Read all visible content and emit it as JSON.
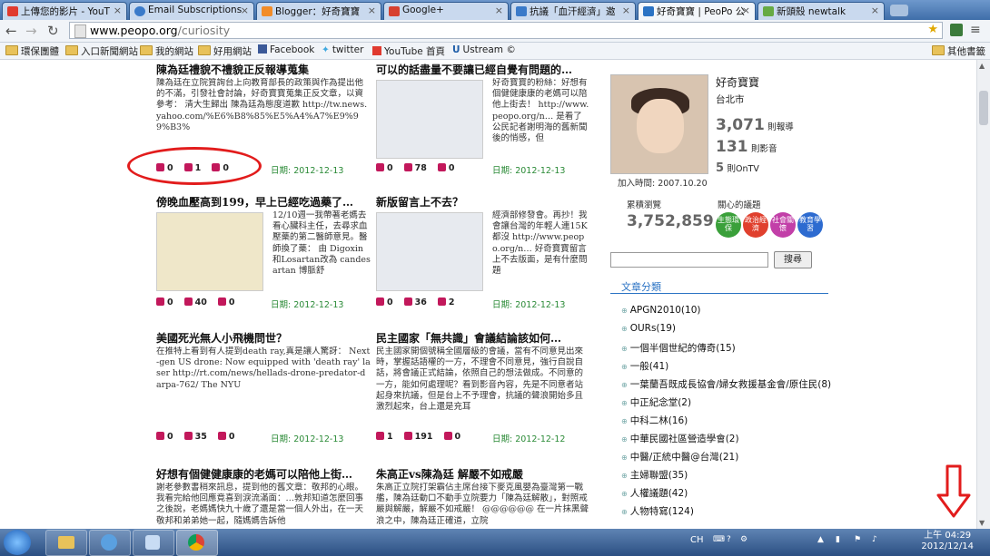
{
  "browser": {
    "tabs": [
      {
        "label": "上傳您的影片 - YouT",
        "color": "#e03a2f",
        "active": false
      },
      {
        "label": "Email Subscriptions",
        "color": "#3a7ac9",
        "active": false
      },
      {
        "label": "Blogger：好奇寶寶",
        "color": "#f28c28",
        "active": false
      },
      {
        "label": "Google+",
        "color": "#d7402f",
        "active": false
      },
      {
        "label": "抗議「血汗經濟」邀",
        "color": "#3a7ac9",
        "active": false
      },
      {
        "label": "好奇寶寶 | PeoPo 公",
        "color": "#2b73c4",
        "active": true
      },
      {
        "label": "新頭殼 newtalk",
        "color": "#66aa44",
        "active": false
      }
    ],
    "url_domain": "www.peopo.org",
    "url_path": "/curiosity",
    "bookmarks": [
      "環保團體",
      "入口新聞網站",
      "我的網站",
      "好用網站",
      "Facebook",
      "twitter",
      "YouTube 首頁",
      "Ustream ©"
    ],
    "other_bookmarks": "其他書籤"
  },
  "posts": [
    {
      "title": "陳為廷禮貌不禮貌正反報導蒐集",
      "body": "陳為廷在立院質詢台上向教育部長的政策與作為提出他的不滿，引發社會討論，好奇寶寶蒐集正反文章，以資參考： 清大生歸出 陳為廷為態度道歉 http://tw.news.yahoo.com/%E6%B8%85%E5%A4%A7%E9%99%B3%",
      "recommend": "0",
      "views": "1",
      "comments": "0",
      "date": "日期: 2012-12-13"
    },
    {
      "title": "可以的話盡量不要讓已經自覺有問題的…",
      "body": "好奇寶寶的粉絲：好想有個健健康康的老媽可以陪他上街去！ http://www.peopo.org/n… 是看了公民記者謝明海的舊新聞後的悄感，但",
      "recommend": "0",
      "views": "78",
      "comments": "0",
      "date": "日期: 2012-12-13"
    },
    {
      "title": "傍晚血壓高到199，早上已經吃過藥了…",
      "body": "12/10週一我帶著老媽去看心臟科主任，去尋求血壓藥的第二醫師意見。醫師換了藥： 由 Digoxin和Losartan改為 candesartan 博脈舒",
      "recommend": "0",
      "views": "40",
      "comments": "0",
      "date": "日期: 2012-12-13"
    },
    {
      "title": "新版留言上不去？",
      "body": "經濟部修發會。再抄！我會讓台灣的年輕人連15K都沒 http://www.peopo.org/n… 好奇寶寶留言上不去版面，是有什麼問題",
      "recommend": "0",
      "views": "36",
      "comments": "2",
      "date": "日期: 2012-12-13"
    },
    {
      "title": "美國死光無人小飛機問世？",
      "body": "在推特上看到有人提到death ray,真是讓人驚訝： Next-gen US drone: Now equipped with 'death ray' laser http://rt.com/news/hellads-drone-predator-darpa-762/ The NYU",
      "recommend": "0",
      "views": "35",
      "comments": "0",
      "date": "日期: 2012-12-13"
    },
    {
      "title": "民主國家「無共識」會議結論該如何…",
      "body": "民主國家開個號稱全國層級的會議，當有不同意見出來時，掌握話語權的一方，不理會不同意見，強行自說自話，將會議正式結論，依照自己的想法做成。不同意的一方，能如何處理呢？看到影音內容，先是不同意者站起身來抗議，但是台上不予理會，抗議的聲浪開始多且激烈起來，台上還是充耳",
      "recommend": "1",
      "views": "191",
      "comments": "0",
      "date": "日期: 2012-12-12"
    },
    {
      "title": "好想有個健健康康的老媽可以陪他上街…",
      "body": "謝老參數書稍來訊息，提到他的舊文章：敬邦的心眼。我看完給他回應竟喜到淚流滿面：…敦邦知道怎麼回事之後說，老媽媽快九十歲了還是當一個人外出，在一天敬邦和弟弟她一起，隨媽媽告訴他",
      "recommend": "",
      "views": "",
      "comments": "",
      "date": ""
    },
    {
      "title": "朱高正vs陳為廷 解嚴不如戒嚴",
      "body": "朱高正立院打架霸佔主席台接下麥克風嬰為臺灣第一戰艦，陳為廷動口不動手立院要力「陳為廷解散」，對照戒嚴與解嚴，解嚴不如戒嚴！ @@@@@@ 在一片抹黑聲浪之中，陳為廷正確道，立院",
      "recommend": "",
      "views": "",
      "comments": "",
      "date": ""
    }
  ],
  "profile": {
    "name": "好奇寶寶",
    "city": "台北市",
    "reports_num": "3,071",
    "reports_label": "則報導",
    "videos_num": "131",
    "videos_label": "則影音",
    "ontv_num": "5",
    "ontv_label": "則OnTV",
    "joined": "加入時間: 2007.10.20",
    "views_label": "累積瀏覽",
    "views_num": "3,752,859",
    "topics_label": "關心的議題",
    "topics": [
      {
        "label": "生態環保",
        "color": "#3aa03a"
      },
      {
        "label": "政治經濟",
        "color": "#e0402e"
      },
      {
        "label": "社會關懷",
        "color": "#c23fa8"
      },
      {
        "label": "教育學習",
        "color": "#2d6bd0"
      }
    ],
    "search_button": "搜尋",
    "categories_title": "文章分類",
    "categories": [
      "APGN2010(10)",
      "OURs(19)",
      "一個半個世紀的傳奇(15)",
      "一般(41)",
      "一葉蘭吾既成長協會/婦女救援基金會/原住民(8)",
      "中正紀念堂(2)",
      "中科二林(16)",
      "中華民國社區營造學會(2)",
      "中醫/正統中醫@台灣(21)",
      "主婦聯盟(35)",
      "人權議題(42)",
      "人物特寫(124)"
    ]
  },
  "taskbar": {
    "time": "上午 04:29",
    "date": "2012/12/14",
    "ime": "CH"
  },
  "colors": {
    "annotation_red": "#e21c1c",
    "accent_blue": "#2b73c4",
    "date_green": "#2a8a36"
  }
}
